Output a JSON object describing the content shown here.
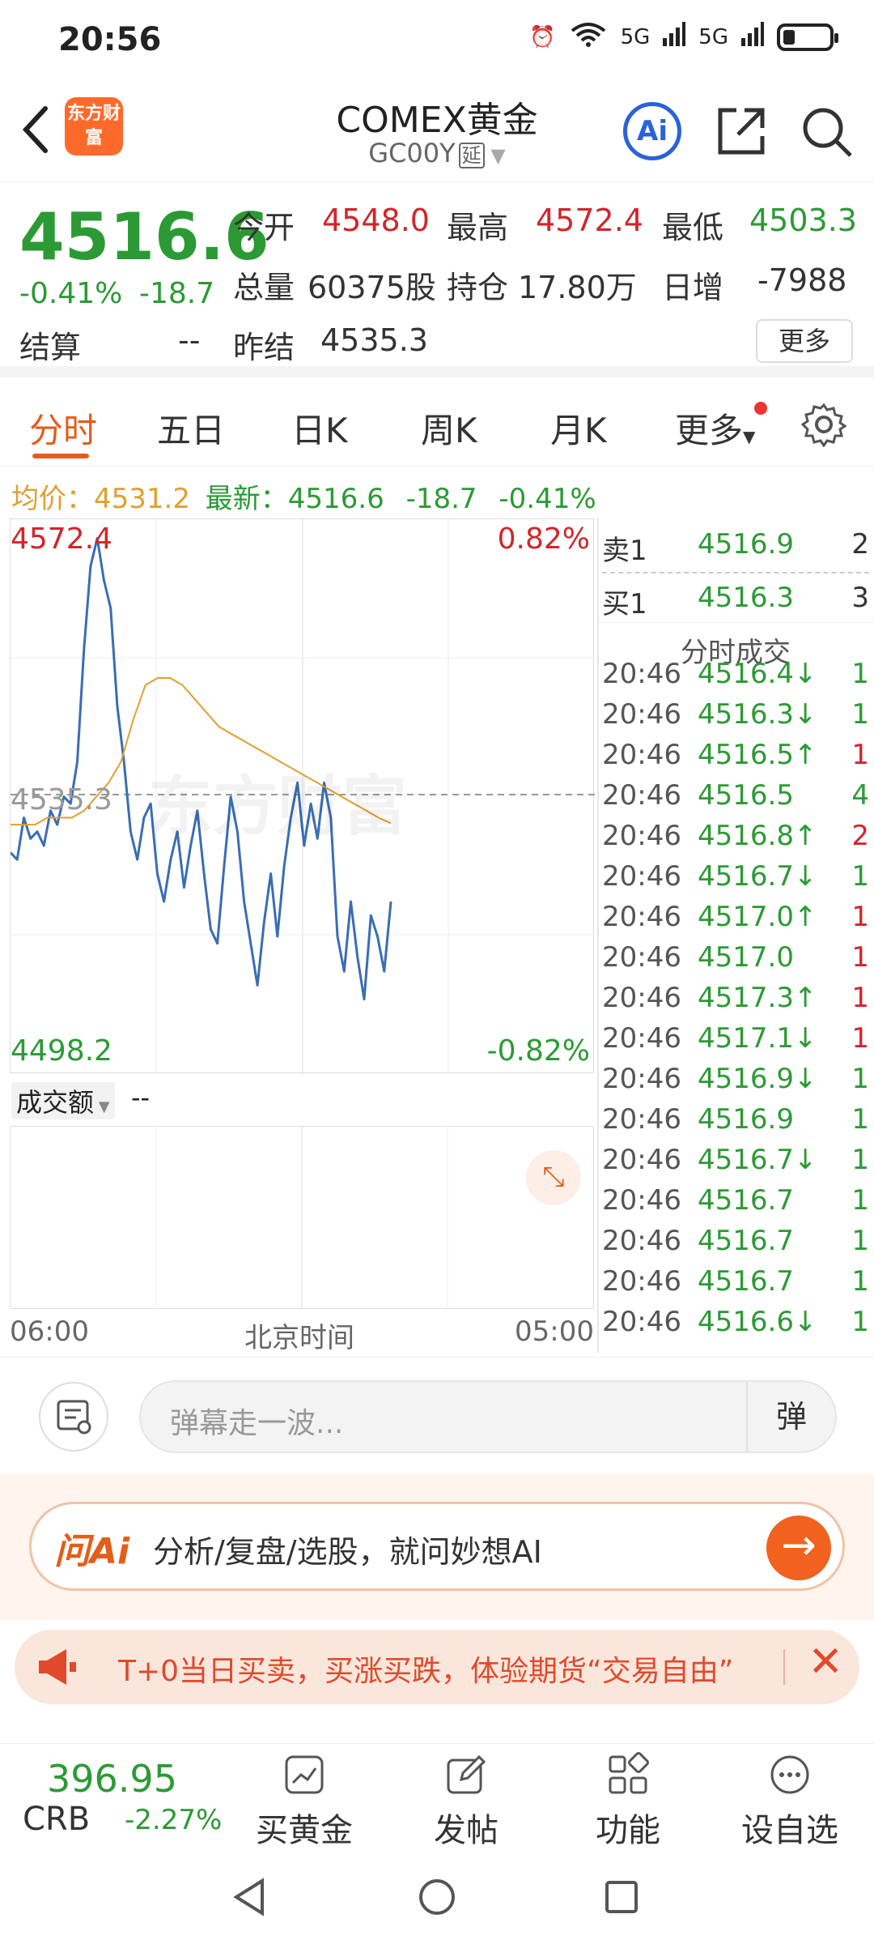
{
  "status": {
    "time": "20:56",
    "net1": "5G",
    "net2": "5G",
    "wifi_sub": "6"
  },
  "header": {
    "title": "COMEX黄金",
    "code": "GC00Y",
    "delay_badge": "延",
    "logo_text": "东方财富",
    "ai_label": "Ai"
  },
  "quote": {
    "price": "4516.6",
    "pct": "-0.41%",
    "chg": "-18.7",
    "open_label": "今开",
    "open": "4548.0",
    "high_label": "最高",
    "high": "4572.4",
    "low_label": "最低",
    "low": "4503.3",
    "volume_label": "总量",
    "volume": "60375股",
    "oi_label": "持仓",
    "oi": "17.80万",
    "daily_inc_label": "日增",
    "daily_inc": "-7988",
    "settle_label": "结算",
    "settle": "--",
    "prev_settle_label": "昨结",
    "prev_settle": "4535.3",
    "more": "更多"
  },
  "tabs": [
    {
      "label": "分时"
    },
    {
      "label": "五日"
    },
    {
      "label": "日K"
    },
    {
      "label": "周K"
    },
    {
      "label": "月K"
    },
    {
      "label": "更多"
    }
  ],
  "avg": {
    "avg_label": "均价：",
    "avg": "4531.2",
    "last_label": "最新：",
    "last": "4516.6",
    "chg": "-18.7",
    "pct": "-0.41%"
  },
  "chart": {
    "top_price": "4572.4",
    "top_pct": "0.82%",
    "mid_price": "4535.3",
    "bottom_price": "4498.2",
    "bottom_pct": "-0.82%",
    "watermark": "东方财富",
    "vol_label": "成交额",
    "vol_value": "--",
    "time_start": "06:00",
    "time_mid": "北京时间",
    "time_end": "05:00",
    "colors": {
      "price": "#3a6db5",
      "avg": "#e0a030"
    }
  },
  "chart_data": {
    "type": "line",
    "ylim": [
      4498.2,
      4572.4
    ],
    "reference": 4535.3,
    "series": [
      {
        "name": "最新",
        "values": [
          4527,
          4526,
          4532,
          4529,
          4530,
          4528,
          4533,
          4531,
          4535,
          4534,
          4540,
          4556,
          4568,
          4572,
          4566,
          4562,
          4548,
          4540,
          4530,
          4526,
          4532,
          4534,
          4524,
          4520,
          4526,
          4530,
          4522,
          4528,
          4533,
          4524,
          4516,
          4514,
          4525,
          4535,
          4530,
          4520,
          4514,
          4508,
          4517,
          4524,
          4515,
          4525,
          4532,
          4537,
          4528,
          4534,
          4529,
          4537,
          4532,
          4515,
          4510,
          4520,
          4512,
          4506,
          4518,
          4515,
          4510,
          4520
        ]
      },
      {
        "name": "均价",
        "values": [
          4531,
          4531,
          4531,
          4532,
          4532,
          4532,
          4533,
          4535,
          4537,
          4540,
          4546,
          4551,
          4552,
          4552,
          4551,
          4549,
          4547,
          4545,
          4544,
          4543,
          4542,
          4541,
          4540,
          4539,
          4538,
          4537,
          4536,
          4535,
          4534,
          4533,
          4532,
          4531.2
        ]
      }
    ]
  },
  "orderbook": {
    "ask_label": "卖1",
    "ask": "4516.9",
    "ask_vol": "2",
    "bid_label": "买1",
    "bid": "4516.3",
    "bid_vol": "3",
    "trades_title": "分时成交"
  },
  "trades": [
    {
      "t": "20:46",
      "p": "4516.4↓",
      "v": "1",
      "pc": "green",
      "vc": "green"
    },
    {
      "t": "20:46",
      "p": "4516.3↓",
      "v": "1",
      "pc": "green",
      "vc": "green"
    },
    {
      "t": "20:46",
      "p": "4516.5↑",
      "v": "1",
      "pc": "green",
      "vc": "red"
    },
    {
      "t": "20:46",
      "p": "4516.5",
      "v": "4",
      "pc": "green",
      "vc": "green"
    },
    {
      "t": "20:46",
      "p": "4516.8↑",
      "v": "2",
      "pc": "green",
      "vc": "red"
    },
    {
      "t": "20:46",
      "p": "4516.7↓",
      "v": "1",
      "pc": "green",
      "vc": "green"
    },
    {
      "t": "20:46",
      "p": "4517.0↑",
      "v": "1",
      "pc": "green",
      "vc": "red"
    },
    {
      "t": "20:46",
      "p": "4517.0",
      "v": "1",
      "pc": "green",
      "vc": "red"
    },
    {
      "t": "20:46",
      "p": "4517.3↑",
      "v": "1",
      "pc": "green",
      "vc": "red"
    },
    {
      "t": "20:46",
      "p": "4517.1↓",
      "v": "1",
      "pc": "green",
      "vc": "red"
    },
    {
      "t": "20:46",
      "p": "4516.9↓",
      "v": "1",
      "pc": "green",
      "vc": "green"
    },
    {
      "t": "20:46",
      "p": "4516.9",
      "v": "1",
      "pc": "green",
      "vc": "green"
    },
    {
      "t": "20:46",
      "p": "4516.7↓",
      "v": "1",
      "pc": "green",
      "vc": "green"
    },
    {
      "t": "20:46",
      "p": "4516.7",
      "v": "1",
      "pc": "green",
      "vc": "green"
    },
    {
      "t": "20:46",
      "p": "4516.7",
      "v": "1",
      "pc": "green",
      "vc": "green"
    },
    {
      "t": "20:46",
      "p": "4516.7",
      "v": "1",
      "pc": "green",
      "vc": "green"
    },
    {
      "t": "20:46",
      "p": "4516.6↓",
      "v": "1",
      "pc": "green",
      "vc": "green"
    }
  ],
  "comment": {
    "placeholder": "弹幕走一波...",
    "danmu": "弹"
  },
  "ai": {
    "brand": "问Ai",
    "text": "分析/复盘/选股，就问妙想AI",
    "go": "→"
  },
  "promo": {
    "text": "T+0当日买卖，买涨买跌，体验期货“交易自由”",
    "close": "✕"
  },
  "bottom": {
    "crb_value": "396.95",
    "crb_label": "CRB",
    "crb_pct": "-2.27%",
    "items": [
      {
        "label": "买黄金"
      },
      {
        "label": "发帖"
      },
      {
        "label": "功能"
      },
      {
        "label": "设自选"
      }
    ]
  }
}
